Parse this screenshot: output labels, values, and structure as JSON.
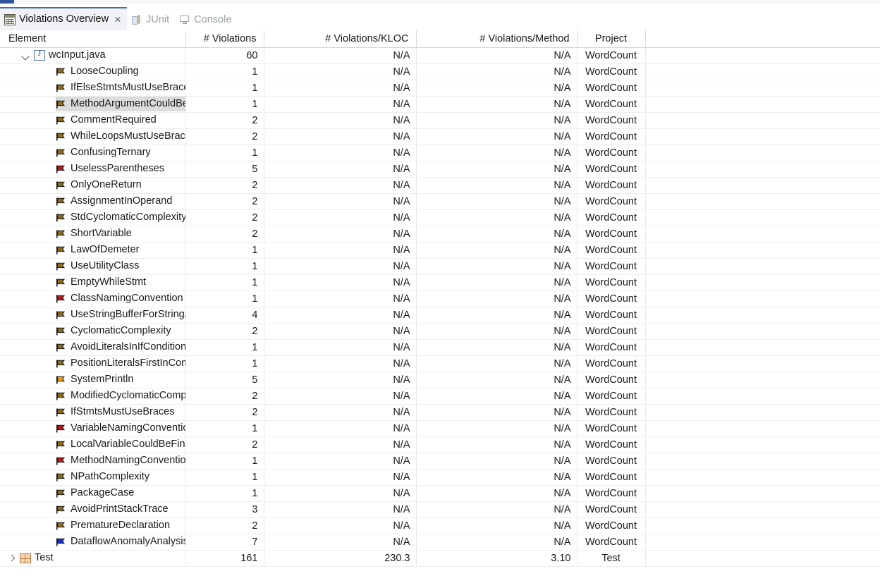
{
  "window": {
    "accent_color": "#2b579a"
  },
  "tabs": [
    {
      "label": "Violations Overview",
      "icon": "violations-overview-icon",
      "active": true,
      "closable": true,
      "close_glyph": "✕"
    },
    {
      "label": "JUnit",
      "icon": "junit-icon",
      "active": false,
      "closable": false
    },
    {
      "label": "Console",
      "icon": "console-icon",
      "active": false,
      "closable": false
    }
  ],
  "table": {
    "columns": [
      {
        "key": "element",
        "label": "Element",
        "align": "left"
      },
      {
        "key": "violations",
        "label": "# Violations",
        "align": "right"
      },
      {
        "key": "kloc",
        "label": "# Violations/KLOC",
        "align": "right"
      },
      {
        "key": "method",
        "label": "# Violations/Method",
        "align": "right"
      },
      {
        "key": "project",
        "label": "Project",
        "align": "center"
      },
      {
        "key": "pad",
        "label": "",
        "align": "left"
      }
    ],
    "rows": [
      {
        "label": "wcInput.java",
        "icon": "java-file-icon",
        "indent": 1,
        "twisty": "down",
        "violations": "60",
        "kloc": "N/A",
        "method": "N/A",
        "project": "WordCount",
        "selected": false,
        "highlight": false
      },
      {
        "label": "LooseCoupling",
        "icon": "flag-gold-icon",
        "indent": 2,
        "twisty": "none",
        "violations": "1",
        "kloc": "N/A",
        "method": "N/A",
        "project": "WordCount",
        "selected": false,
        "highlight": true
      },
      {
        "label": "IfElseStmtsMustUseBraces",
        "icon": "flag-gold-icon",
        "indent": 2,
        "twisty": "none",
        "violations": "1",
        "kloc": "N/A",
        "method": "N/A",
        "project": "WordCount",
        "selected": false,
        "highlight": true
      },
      {
        "label": "MethodArgumentCouldBeFinal",
        "icon": "flag-gold-icon",
        "indent": 2,
        "twisty": "none",
        "violations": "1",
        "kloc": "N/A",
        "method": "N/A",
        "project": "WordCount",
        "selected": true,
        "highlight": true
      },
      {
        "label": "CommentRequired",
        "icon": "flag-gold-icon",
        "indent": 2,
        "twisty": "none",
        "violations": "2",
        "kloc": "N/A",
        "method": "N/A",
        "project": "WordCount",
        "selected": false,
        "highlight": false
      },
      {
        "label": "WhileLoopsMustUseBraces",
        "icon": "flag-gold-icon",
        "indent": 2,
        "twisty": "none",
        "violations": "2",
        "kloc": "N/A",
        "method": "N/A",
        "project": "WordCount",
        "selected": false,
        "highlight": false
      },
      {
        "label": "ConfusingTernary",
        "icon": "flag-gold-icon",
        "indent": 2,
        "twisty": "none",
        "violations": "1",
        "kloc": "N/A",
        "method": "N/A",
        "project": "WordCount",
        "selected": false,
        "highlight": true
      },
      {
        "label": "UselessParentheses",
        "icon": "flag-red-icon",
        "indent": 2,
        "twisty": "none",
        "violations": "5",
        "kloc": "N/A",
        "method": "N/A",
        "project": "WordCount",
        "selected": false,
        "highlight": false
      },
      {
        "label": "OnlyOneReturn",
        "icon": "flag-gold-icon",
        "indent": 2,
        "twisty": "none",
        "violations": "2",
        "kloc": "N/A",
        "method": "N/A",
        "project": "WordCount",
        "selected": false,
        "highlight": false
      },
      {
        "label": "AssignmentInOperand",
        "icon": "flag-gold-icon",
        "indent": 2,
        "twisty": "none",
        "violations": "2",
        "kloc": "N/A",
        "method": "N/A",
        "project": "WordCount",
        "selected": false,
        "highlight": false
      },
      {
        "label": "StdCyclomaticComplexity",
        "icon": "flag-gold-icon",
        "indent": 2,
        "twisty": "none",
        "violations": "2",
        "kloc": "N/A",
        "method": "N/A",
        "project": "WordCount",
        "selected": false,
        "highlight": false
      },
      {
        "label": "ShortVariable",
        "icon": "flag-gold-icon",
        "indent": 2,
        "twisty": "none",
        "violations": "2",
        "kloc": "N/A",
        "method": "N/A",
        "project": "WordCount",
        "selected": false,
        "highlight": false
      },
      {
        "label": "LawOfDemeter",
        "icon": "flag-gold-icon",
        "indent": 2,
        "twisty": "none",
        "violations": "1",
        "kloc": "N/A",
        "method": "N/A",
        "project": "WordCount",
        "selected": false,
        "highlight": true
      },
      {
        "label": "UseUtilityClass",
        "icon": "flag-gold-icon",
        "indent": 2,
        "twisty": "none",
        "violations": "1",
        "kloc": "N/A",
        "method": "N/A",
        "project": "WordCount",
        "selected": false,
        "highlight": true
      },
      {
        "label": "EmptyWhileStmt",
        "icon": "flag-gold-icon",
        "indent": 2,
        "twisty": "none",
        "violations": "1",
        "kloc": "N/A",
        "method": "N/A",
        "project": "WordCount",
        "selected": false,
        "highlight": true
      },
      {
        "label": "ClassNamingConvention",
        "icon": "flag-red-icon",
        "indent": 2,
        "twisty": "none",
        "violations": "1",
        "kloc": "N/A",
        "method": "N/A",
        "project": "WordCount",
        "selected": false,
        "highlight": true
      },
      {
        "label": "UseStringBufferForStringAppends",
        "icon": "flag-gold-icon",
        "indent": 2,
        "twisty": "none",
        "violations": "4",
        "kloc": "N/A",
        "method": "N/A",
        "project": "WordCount",
        "selected": false,
        "highlight": false
      },
      {
        "label": "CyclomaticComplexity",
        "icon": "flag-gold-icon",
        "indent": 2,
        "twisty": "none",
        "violations": "2",
        "kloc": "N/A",
        "method": "N/A",
        "project": "WordCount",
        "selected": false,
        "highlight": false
      },
      {
        "label": "AvoidLiteralsInIfCondition",
        "icon": "flag-gold-icon",
        "indent": 2,
        "twisty": "none",
        "violations": "1",
        "kloc": "N/A",
        "method": "N/A",
        "project": "WordCount",
        "selected": false,
        "highlight": true
      },
      {
        "label": "PositionLiteralsFirstInComparisons",
        "icon": "flag-gold-icon",
        "indent": 2,
        "twisty": "none",
        "violations": "1",
        "kloc": "N/A",
        "method": "N/A",
        "project": "WordCount",
        "selected": false,
        "highlight": true
      },
      {
        "label": "SystemPrintln",
        "icon": "flag-orange-icon",
        "indent": 2,
        "twisty": "none",
        "violations": "5",
        "kloc": "N/A",
        "method": "N/A",
        "project": "WordCount",
        "selected": false,
        "highlight": false
      },
      {
        "label": "ModifiedCyclomaticComplexity",
        "icon": "flag-gold-icon",
        "indent": 2,
        "twisty": "none",
        "violations": "2",
        "kloc": "N/A",
        "method": "N/A",
        "project": "WordCount",
        "selected": false,
        "highlight": false
      },
      {
        "label": "IfStmtsMustUseBraces",
        "icon": "flag-gold-icon",
        "indent": 2,
        "twisty": "none",
        "violations": "2",
        "kloc": "N/A",
        "method": "N/A",
        "project": "WordCount",
        "selected": false,
        "highlight": false
      },
      {
        "label": "VariableNamingConventions",
        "icon": "flag-red-icon",
        "indent": 2,
        "twisty": "none",
        "violations": "1",
        "kloc": "N/A",
        "method": "N/A",
        "project": "WordCount",
        "selected": false,
        "highlight": true
      },
      {
        "label": "LocalVariableCouldBeFinal",
        "icon": "flag-gold-icon",
        "indent": 2,
        "twisty": "none",
        "violations": "2",
        "kloc": "N/A",
        "method": "N/A",
        "project": "WordCount",
        "selected": false,
        "highlight": false
      },
      {
        "label": "MethodNamingConventions",
        "icon": "flag-red-icon",
        "indent": 2,
        "twisty": "none",
        "violations": "1",
        "kloc": "N/A",
        "method": "N/A",
        "project": "WordCount",
        "selected": false,
        "highlight": true
      },
      {
        "label": "NPathComplexity",
        "icon": "flag-gold-icon",
        "indent": 2,
        "twisty": "none",
        "violations": "1",
        "kloc": "N/A",
        "method": "N/A",
        "project": "WordCount",
        "selected": false,
        "highlight": true
      },
      {
        "label": "PackageCase",
        "icon": "flag-gold-icon",
        "indent": 2,
        "twisty": "none",
        "violations": "1",
        "kloc": "N/A",
        "method": "N/A",
        "project": "WordCount",
        "selected": false,
        "highlight": true
      },
      {
        "label": "AvoidPrintStackTrace",
        "icon": "flag-gold-icon",
        "indent": 2,
        "twisty": "none",
        "violations": "3",
        "kloc": "N/A",
        "method": "N/A",
        "project": "WordCount",
        "selected": false,
        "highlight": false
      },
      {
        "label": "PrematureDeclaration",
        "icon": "flag-gold-icon",
        "indent": 2,
        "twisty": "none",
        "violations": "2",
        "kloc": "N/A",
        "method": "N/A",
        "project": "WordCount",
        "selected": false,
        "highlight": false
      },
      {
        "label": "DataflowAnomalyAnalysis",
        "icon": "flag-blue-icon",
        "indent": 2,
        "twisty": "none",
        "violations": "7",
        "kloc": "N/A",
        "method": "N/A",
        "project": "WordCount",
        "selected": false,
        "highlight": false
      },
      {
        "label": "Test",
        "icon": "package-icon",
        "indent": 0,
        "twisty": "right",
        "violations": "161",
        "kloc": "230.3",
        "method": "3.10",
        "project": "Test",
        "selected": false,
        "highlight": false
      }
    ]
  },
  "colors": {
    "flag_gold": "#8a6d1f",
    "flag_red": "#b01a1a",
    "flag_orange": "#f0a018",
    "flag_blue": "#1a2ecc",
    "selection_bg": "#dcdcdc",
    "value_highlight": "#a06a12",
    "grid_line": "#e6e8ea"
  }
}
